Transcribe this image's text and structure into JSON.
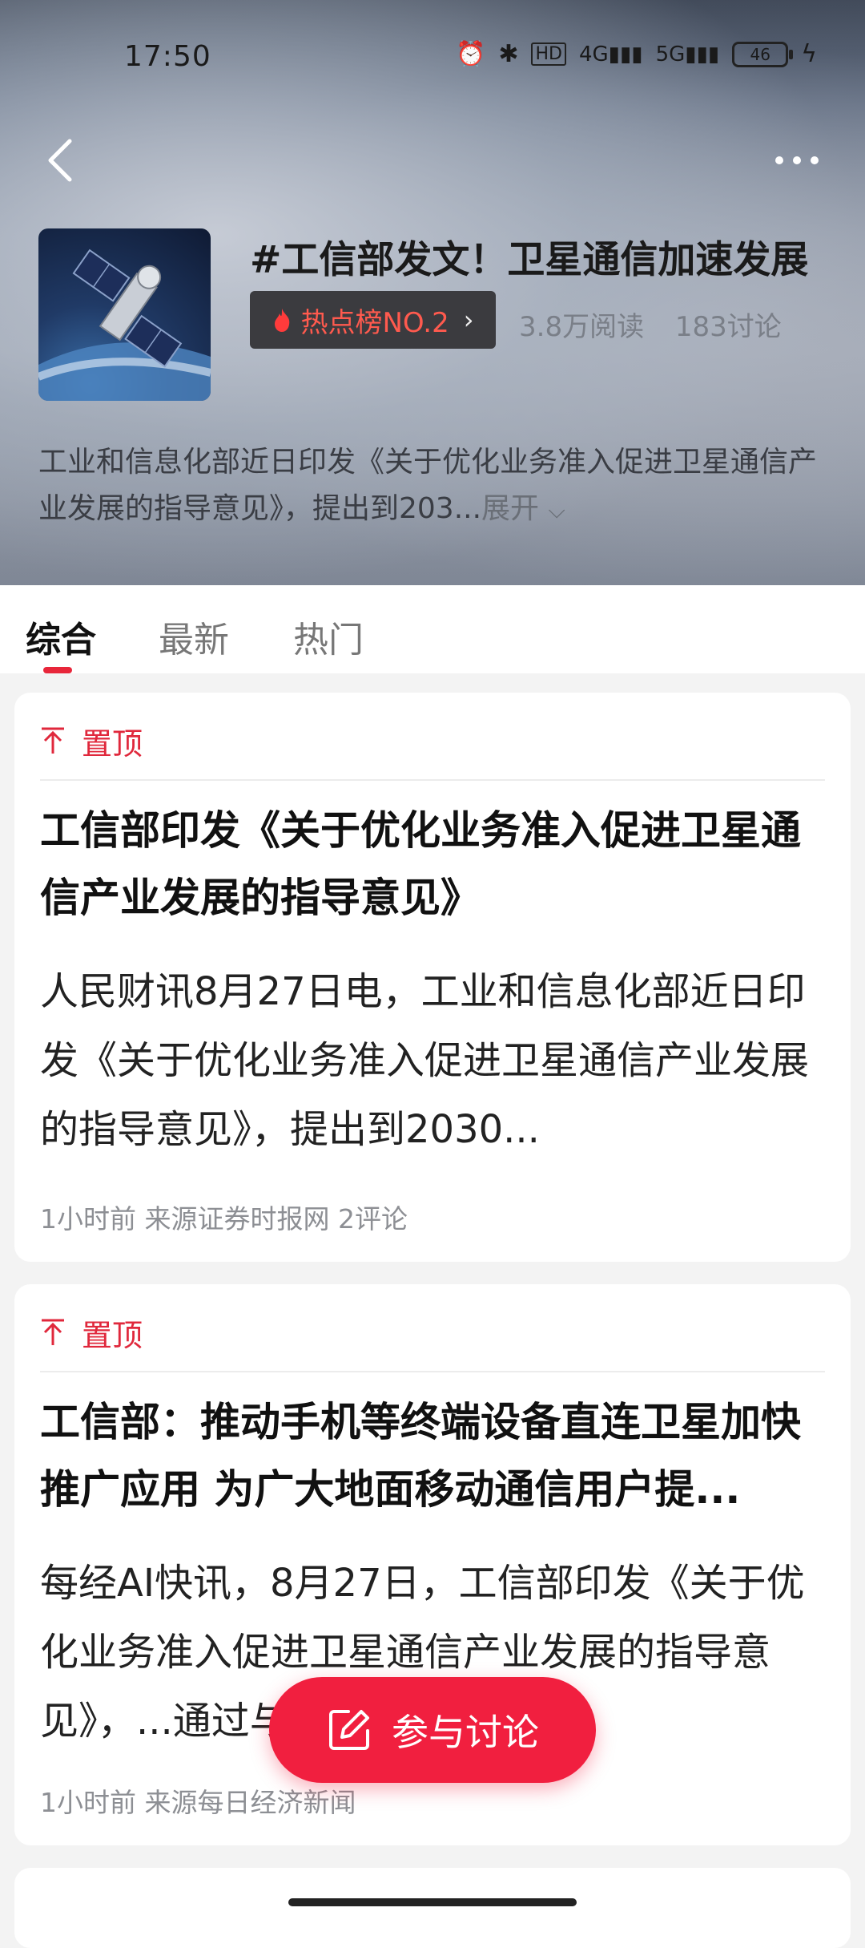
{
  "status_bar": {
    "time": "17:50",
    "battery": "46",
    "icons": [
      "alarm-icon",
      "bluetooth-icon",
      "hd-icon",
      "signal-4g-icon",
      "signal-5g-icon",
      "battery-icon",
      "charging-icon"
    ]
  },
  "header": {
    "topic_title": "#工信部发文！卫星通信加速发展",
    "hot_badge": "热点榜NO.2",
    "reads": "3.8万阅读",
    "discussions": "183讨论",
    "description": "工业和信息化部近日印发《关于优化业务准入促进卫星通信产业发展的指导意见》，提出到203...",
    "expand_label": "展开"
  },
  "tabs": [
    {
      "label": "综合",
      "active": true
    },
    {
      "label": "最新",
      "active": false
    },
    {
      "label": "热门",
      "active": false
    }
  ],
  "cards": [
    {
      "pin_label": "置顶",
      "title": "工信部印发《关于优化业务准入促进卫星通信产业发展的指导意见》",
      "summary": "人民财讯8月27日电，工业和信息化部近日印发《关于优化业务准入促进卫星通信产业发展的指导意见》，提出到2030...",
      "meta": "1小时前 来源证券时报网 2评论"
    },
    {
      "pin_label": "置顶",
      "title": "工信部：推动手机等终端设备直连卫星加快推广应用 为广大地面移动通信用户提...",
      "summary": "每经AI快讯，8月27日，工信部印发《关于优化业务准入促进卫星通信产业发展的指导意见》，...通过与卫...",
      "meta": "1小时前 来源每日经济新闻"
    }
  ],
  "fab": {
    "label": "参与讨论"
  },
  "colors": {
    "accent": "#e8263a",
    "fab": "#f11f3f",
    "badge_bg": "#3b3b3f"
  }
}
